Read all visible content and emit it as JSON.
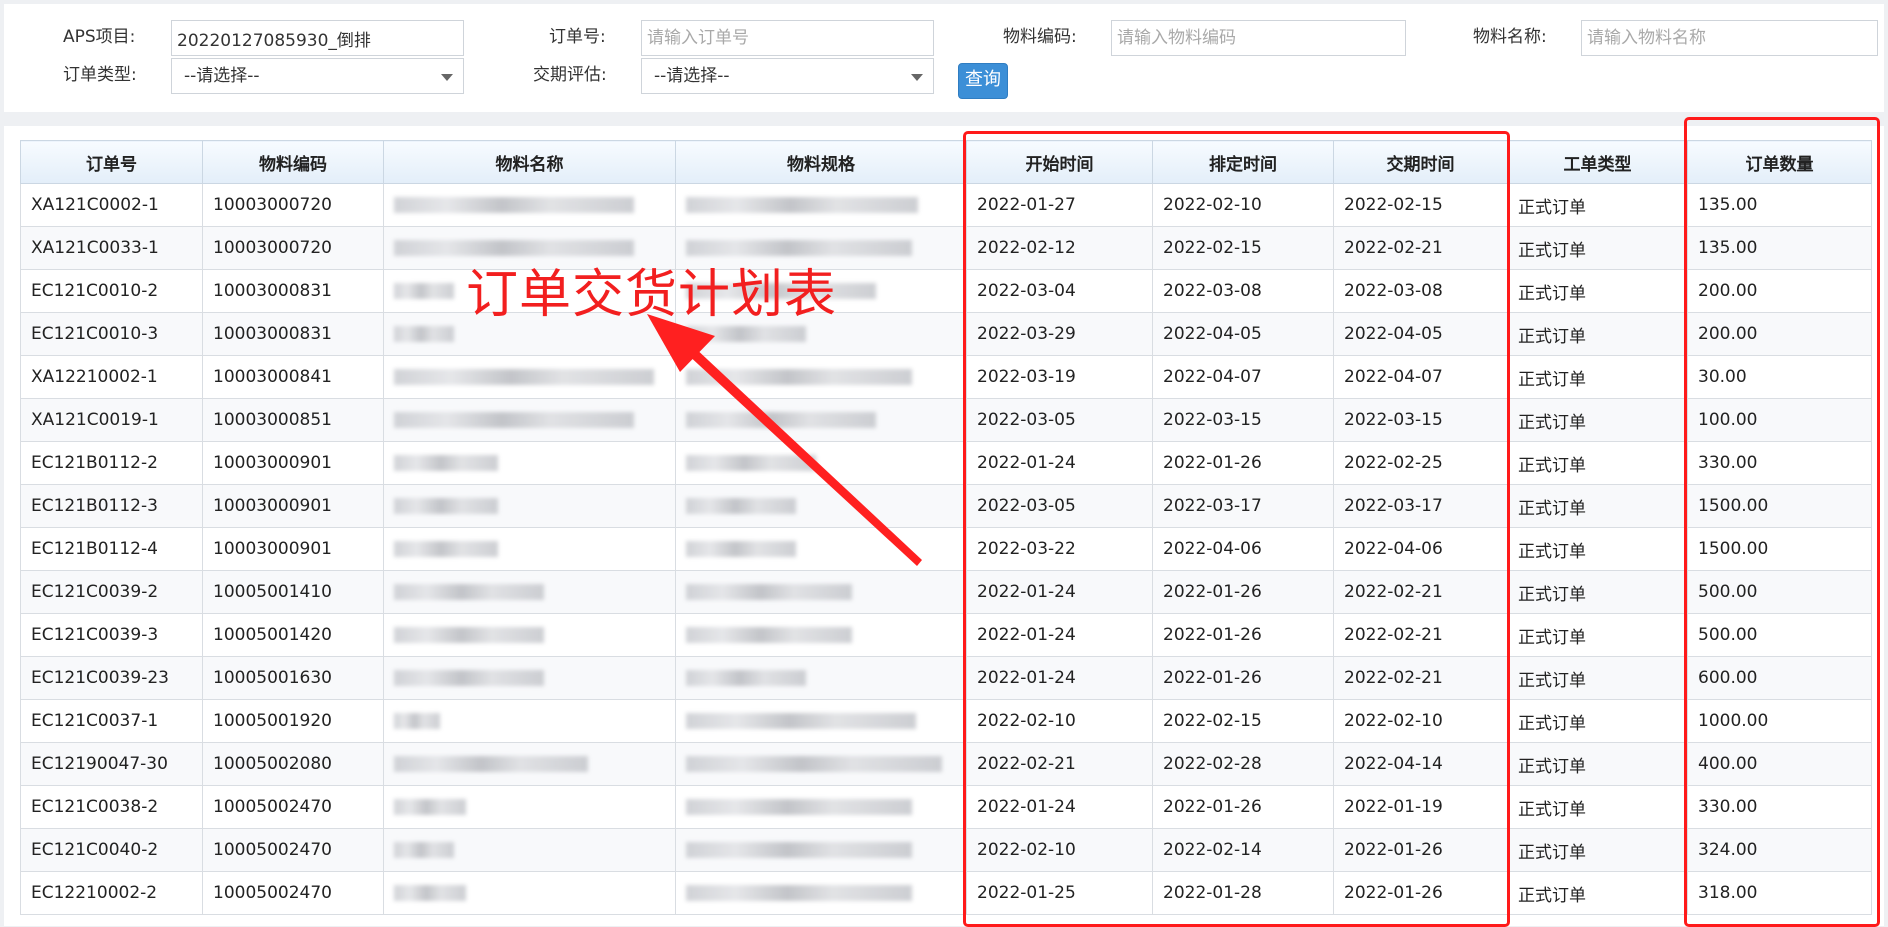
{
  "search": {
    "project_label": "APS项目:",
    "project_value": "20220127085930_倒排",
    "order_no_label": "订单号:",
    "order_no_placeholder": "请输入订单号",
    "material_code_label": "物料编码:",
    "material_code_placeholder": "请输入物料编码",
    "material_name_label": "物料名称:",
    "material_name_placeholder": "请输入物料名称",
    "order_type_label": "订单类型:",
    "order_type_value": "--请选择--",
    "delivery_eval_label": "交期评估:",
    "delivery_eval_value": "--请选择--",
    "query_label": "查询"
  },
  "table": {
    "columns": [
      "订单号",
      "物料编码",
      "物料名称",
      "物料规格",
      "开始时间",
      "排定时间",
      "交期时间",
      "工单类型",
      "订单数量"
    ],
    "rows": [
      {
        "order": "XA121C0002-1",
        "code": "10003000720",
        "start": "2022-01-27",
        "scheduled": "2022-02-10",
        "due": "2022-02-15",
        "type": "正式订单",
        "qty": "135.00"
      },
      {
        "order": "XA121C0033-1",
        "code": "10003000720",
        "start": "2022-02-12",
        "scheduled": "2022-02-15",
        "due": "2022-02-21",
        "type": "正式订单",
        "qty": "135.00"
      },
      {
        "order": "EC121C0010-2",
        "code": "10003000831",
        "start": "2022-03-04",
        "scheduled": "2022-03-08",
        "due": "2022-03-08",
        "type": "正式订单",
        "qty": "200.00"
      },
      {
        "order": "EC121C0010-3",
        "code": "10003000831",
        "start": "2022-03-29",
        "scheduled": "2022-04-05",
        "due": "2022-04-05",
        "type": "正式订单",
        "qty": "200.00"
      },
      {
        "order": "XA12210002-1",
        "code": "10003000841",
        "start": "2022-03-19",
        "scheduled": "2022-04-07",
        "due": "2022-04-07",
        "type": "正式订单",
        "qty": "30.00"
      },
      {
        "order": "XA121C0019-1",
        "code": "10003000851",
        "start": "2022-03-05",
        "scheduled": "2022-03-15",
        "due": "2022-03-15",
        "type": "正式订单",
        "qty": "100.00"
      },
      {
        "order": "EC121B0112-2",
        "code": "10003000901",
        "start": "2022-01-24",
        "scheduled": "2022-01-26",
        "due": "2022-02-25",
        "type": "正式订单",
        "qty": "330.00"
      },
      {
        "order": "EC121B0112-3",
        "code": "10003000901",
        "start": "2022-03-05",
        "scheduled": "2022-03-17",
        "due": "2022-03-17",
        "type": "正式订单",
        "qty": "1500.00"
      },
      {
        "order": "EC121B0112-4",
        "code": "10003000901",
        "start": "2022-03-22",
        "scheduled": "2022-04-06",
        "due": "2022-04-06",
        "type": "正式订单",
        "qty": "1500.00"
      },
      {
        "order": "EC121C0039-2",
        "code": "10005001410",
        "start": "2022-01-24",
        "scheduled": "2022-01-26",
        "due": "2022-02-21",
        "type": "正式订单",
        "qty": "500.00"
      },
      {
        "order": "EC121C0039-3",
        "code": "10005001420",
        "start": "2022-01-24",
        "scheduled": "2022-01-26",
        "due": "2022-02-21",
        "type": "正式订单",
        "qty": "500.00"
      },
      {
        "order": "EC121C0039-23",
        "code": "10005001630",
        "start": "2022-01-24",
        "scheduled": "2022-01-26",
        "due": "2022-02-21",
        "type": "正式订单",
        "qty": "600.00"
      },
      {
        "order": "EC121C0037-1",
        "code": "10005001920",
        "start": "2022-02-10",
        "scheduled": "2022-02-15",
        "due": "2022-02-10",
        "type": "正式订单",
        "qty": "1000.00"
      },
      {
        "order": "EC12190047-30",
        "code": "10005002080",
        "start": "2022-02-21",
        "scheduled": "2022-02-28",
        "due": "2022-04-14",
        "type": "正式订单",
        "qty": "400.00"
      },
      {
        "order": "EC121C0038-2",
        "code": "10005002470",
        "start": "2022-01-24",
        "scheduled": "2022-01-26",
        "due": "2022-01-19",
        "type": "正式订单",
        "qty": "330.00"
      },
      {
        "order": "EC121C0040-2",
        "code": "10005002470",
        "start": "2022-02-10",
        "scheduled": "2022-02-14",
        "due": "2022-01-26",
        "type": "正式订单",
        "qty": "324.00"
      },
      {
        "order": "EC12210002-2",
        "code": "10005002470",
        "start": "2022-01-25",
        "scheduled": "2022-01-28",
        "due": "2022-01-26",
        "type": "正式订单",
        "qty": "318.00"
      }
    ]
  },
  "annotation": {
    "text": "订单交货计划表",
    "color": "#ff1a1a"
  },
  "colors": {
    "accent": "#3c8fd7",
    "header_bg": "#e3eef9",
    "highlight": "#ff1a1a"
  }
}
